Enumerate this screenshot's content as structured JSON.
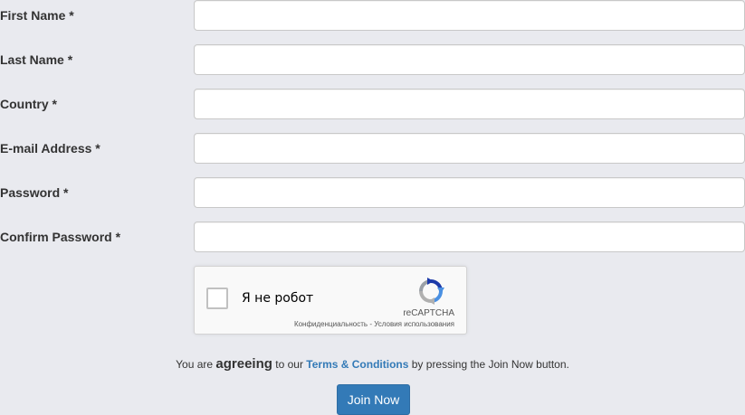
{
  "form": {
    "fields": [
      {
        "label": "First Name *",
        "value": "",
        "placeholder": ""
      },
      {
        "label": "Last Name *",
        "value": "",
        "placeholder": ""
      },
      {
        "label": "Country *",
        "value": "",
        "placeholder": ""
      },
      {
        "label": "E-mail Address *",
        "value": "",
        "placeholder": ""
      },
      {
        "label": "Password *",
        "value": "",
        "placeholder": ""
      },
      {
        "label": "Confirm Password *",
        "value": "",
        "placeholder": ""
      }
    ]
  },
  "recaptcha": {
    "label": "Я не робот",
    "brand": "reCAPTCHA",
    "privacy": "Конфиденциальность",
    "separator": " - ",
    "terms": "Условия использования",
    "checked": false
  },
  "agreement": {
    "prefix": "You are ",
    "emphasis": "agreeing",
    "middle": " to our ",
    "link": "Terms & Conditions",
    "suffix": " by pressing the Join Now button."
  },
  "submit": {
    "label": "Join Now"
  },
  "colors": {
    "background": "#e9eaef",
    "link": "#337ab7",
    "button": "#337ab7"
  },
  "icons": {
    "recaptcha_logo": "recaptcha-logo-icon"
  }
}
